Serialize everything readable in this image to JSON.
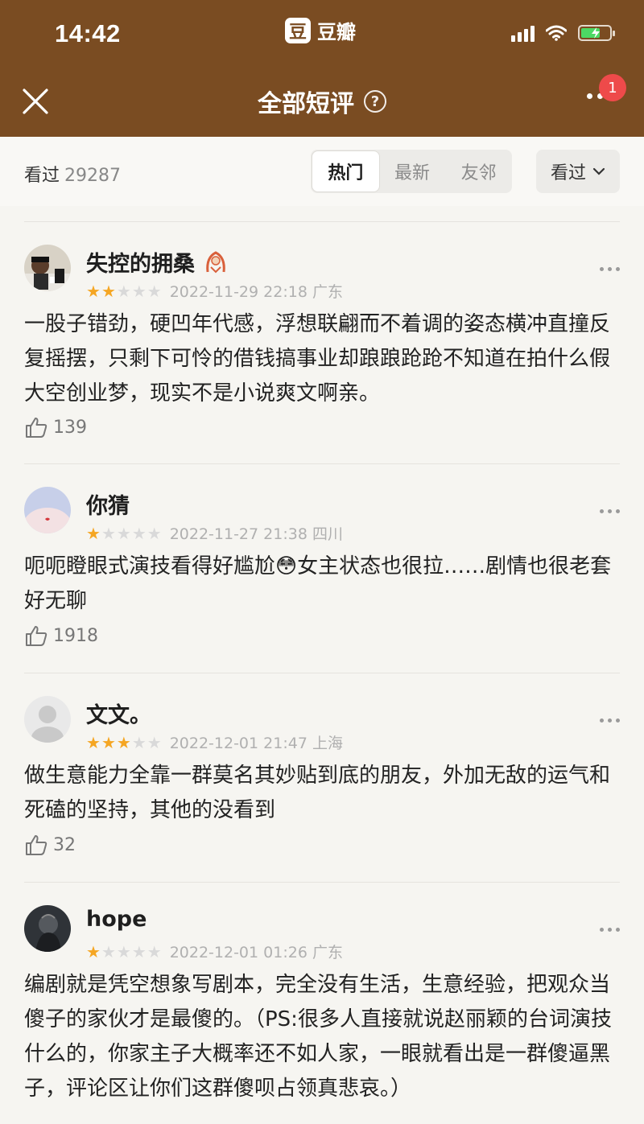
{
  "status_bar": {
    "time": "14:42"
  },
  "app": {
    "logo_char": "豆",
    "name": "豆瓣"
  },
  "nav": {
    "title": "全部短评",
    "help": "?",
    "badge": "1"
  },
  "filter": {
    "watched_label": "看过",
    "watched_count": "29287",
    "tabs": [
      "热门",
      "最新",
      "友邻"
    ],
    "active_tab": "热门",
    "status_select": "看过"
  },
  "comments": [
    {
      "user": "失控的拥桑",
      "rating": 2,
      "meta": "2022-11-29 22:18 广东",
      "text": "一股子错劲，硬凹年代感，浮想联翩而不着调的姿态横冲直撞反复摇摆，只剩下可怜的借钱搞事业却踉踉跄跄不知道在拍什么假大空创业梦，现实不是小说爽文啊亲。",
      "likes": "139"
    },
    {
      "user": "你猜",
      "rating": 1,
      "meta": "2022-11-27 21:38 四川",
      "text": "呃呃瞪眼式演技看得好尴尬😳女主状态也很拉……剧情也很老套好无聊",
      "likes": "1918"
    },
    {
      "user": "文文。",
      "rating": 3,
      "meta": "2022-12-01 21:47 上海",
      "text": "做生意能力全靠一群莫名其妙贴到底的朋友，外加无敌的运气和死磕的坚持，其他的没看到",
      "likes": "32"
    },
    {
      "user": "hope",
      "rating": 1,
      "meta": "2022-12-01 01:26 广东",
      "text": "编剧就是凭空想象写剧本，完全没有生活，生意经验，把观众当傻子的家伙才是最傻的。（PS:很多人直接就说赵丽颖的台词演技什么的，你家主子大概率还不如人家，一眼就看出是一群傻逼黑子，评论区让你们这群傻呗占领真悲哀。）",
      "likes": ""
    }
  ],
  "colors": {
    "header": "#7a4c22",
    "star": "#f5a623",
    "badge": "#ee4a4a"
  },
  "icons": [
    "signal-icon",
    "wifi-icon",
    "battery-icon",
    "close-icon",
    "help-icon",
    "more-icon",
    "chevron-down-icon",
    "thumbs-up-icon",
    "menu-dots-icon"
  ]
}
